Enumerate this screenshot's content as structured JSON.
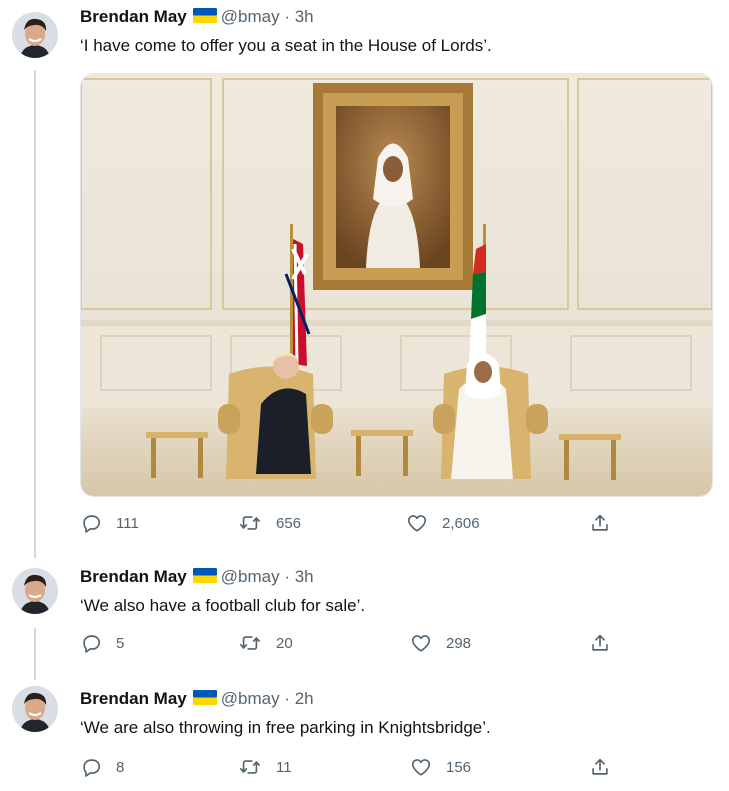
{
  "tweets": [
    {
      "author": "Brendan May",
      "handle": "@bmay",
      "separator": "·",
      "time": "3h",
      "text": "‘I have come to offer you a seat in the House of Lords’.",
      "replies": "111",
      "retweets": "656",
      "likes": "2,606"
    },
    {
      "author": "Brendan May",
      "handle": "@bmay",
      "separator": "·",
      "time": "3h",
      "text": "‘We also have a football club for sale’.",
      "replies": "5",
      "retweets": "20",
      "likes": "298"
    },
    {
      "author": "Brendan May",
      "handle": "@bmay",
      "separator": "·",
      "time": "2h",
      "text": "‘We are also throwing in free parking in Knightsbridge’.",
      "replies": "8",
      "retweets": "11",
      "likes": "156"
    }
  ],
  "icons": {
    "reply": "reply-icon",
    "retweet": "retweet-icon",
    "like": "heart-icon",
    "share": "share-icon",
    "flag": "ukraine-flag-icon"
  },
  "colors": {
    "text": "#0f1419",
    "secondary": "#536471",
    "thread_line": "#cfd9de",
    "flag_blue": "#0057b7",
    "flag_yellow": "#ffd700"
  }
}
